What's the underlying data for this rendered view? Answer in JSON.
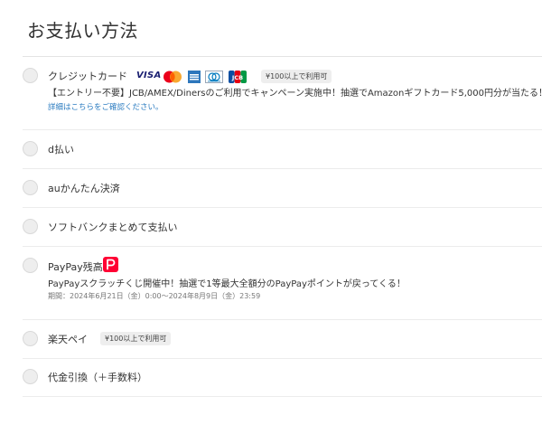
{
  "page": {
    "title": "お支払い方法"
  },
  "payment_options": {
    "credit_card": {
      "label": "クレジットカード",
      "badge": "¥100以上で利用可",
      "brand_icons": [
        "visa-icon",
        "mastercard-icon",
        "amex-icon",
        "diners-icon",
        "jcb-icon"
      ],
      "visa_text": "VISA",
      "jcb_text": "JCB",
      "campaign": "【エントリー不要】JCB/AMEX/Dinersのご利用でキャンペーン実施中！抽選でAmazonギフトカード5,000円分が当たる！",
      "details_link": "詳細はこちらをご確認ください。"
    },
    "d_barai": {
      "label": "d払い"
    },
    "au": {
      "label": "auかんたん決済"
    },
    "softbank": {
      "label": "ソフトバンクまとめて支払い"
    },
    "paypay": {
      "label": "PayPay残高",
      "icon": "paypay-logo-icon",
      "campaign": "PayPayスクラッチくじ開催中！抽選で1等最大全額分のPayPayポイントが戻ってくる！",
      "period": "期間：2024年6月21日（金）0:00〜2024年8月9日（金）23:59"
    },
    "rakuten": {
      "label": "楽天ペイ",
      "badge": "¥100以上で利用可"
    },
    "cod": {
      "label": "代金引換（＋手数料）"
    }
  },
  "colors": {
    "accent_link": "#2a7bc0",
    "paypay_red": "#ff0033",
    "visa_blue": "#1a1f71",
    "amex_blue": "#2e77bc",
    "mastercard_red": "#eb001b",
    "mastercard_orange": "#f79e1b"
  }
}
